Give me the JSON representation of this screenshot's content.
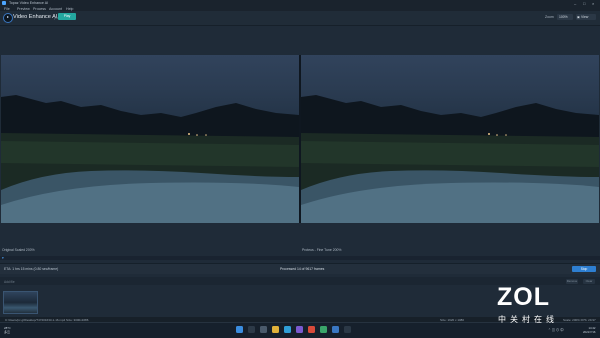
{
  "window": {
    "title": "Topaz Video Enhance AI"
  },
  "menu": [
    "File",
    "Preview",
    "Process",
    "Account",
    "Help"
  ],
  "header": {
    "product_name": "Video Enhance AI",
    "product_sub": "(beta)",
    "play_label": "Play",
    "zoom_label": "Zoom",
    "zoom_value": "100%",
    "view_value": "View"
  },
  "preview": {
    "left_label": "Original Scaled 200%",
    "right_label": "Proteus - Fine Tune 200%"
  },
  "status": {
    "left": "ETA: 1 hrs 15 mins (0.80 sec/frame)",
    "center": "Processed 14 of 9617 frames",
    "export_label": "Stop"
  },
  "queue": {
    "label": "Add file",
    "buttons": [
      "Remove",
      "Clear"
    ]
  },
  "footer": {
    "file_info": "C:/Users/pc.gl/Desktop/747201633-1-16.mp4   Size: 3000x1686",
    "right": "Size: 1920 x 1080",
    "fps": "Scale: 200%   FPS: 29.97"
  },
  "taskbar": {
    "weather_temp": "28°C",
    "weather_desc": "多云",
    "time": "14:42",
    "date": "2021/7/16"
  },
  "watermark": {
    "brand": "ZOL",
    "brand_cn": "中关村在线"
  },
  "colors": {
    "accent": "#24a8a0",
    "export": "#2e7fd1",
    "background": "#1f2b38"
  }
}
